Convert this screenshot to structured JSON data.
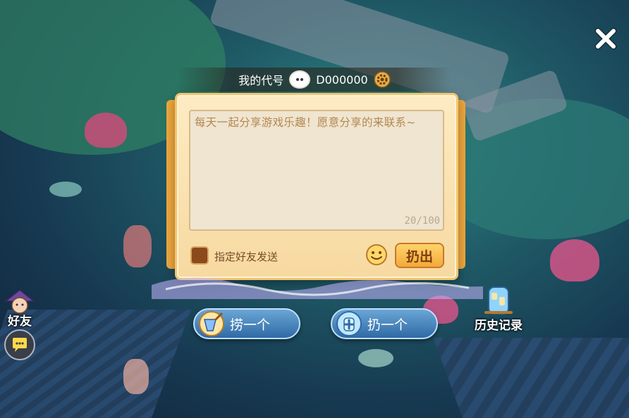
{
  "header": {
    "code_label": "我的代号",
    "code_value": "D000000",
    "icons": [
      "avatar-icon",
      "gear-icon"
    ]
  },
  "message": {
    "text": "每天一起分享游戏乐趣！愿意分享的来联系~",
    "counter": "20/100"
  },
  "options": {
    "designated_friend_label": "指定好友发送",
    "designated_friend_checked": false
  },
  "buttons": {
    "throw_label": "扔出",
    "fish_label": "捞一个",
    "throw_one_label": "扔一个",
    "history_label": "历史记录",
    "friends_label": "好友"
  },
  "icons": [
    "close-icon",
    "emoji-icon",
    "fishing-net-icon",
    "bottle-plus-icon",
    "history-jar-icon",
    "friend-avatar-icon",
    "chat-bubble-icon"
  ],
  "colors": {
    "panel": "#fdebc3",
    "panel_border": "#f3c36e",
    "primary_button": "#f3a93a",
    "pill_button": "#2f6aa5",
    "message_text": "#b4864f"
  }
}
